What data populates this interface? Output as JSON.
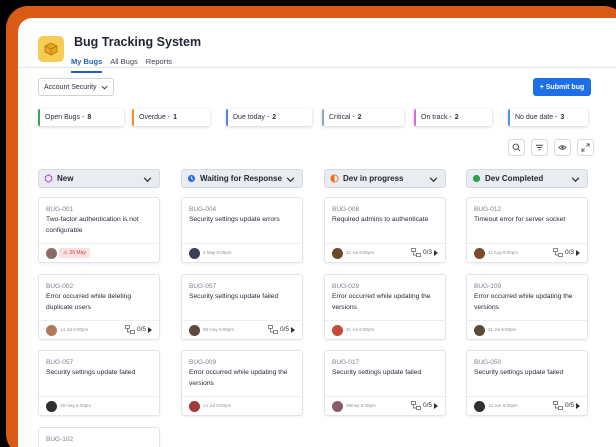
{
  "app": {
    "title": "Bug Tracking System"
  },
  "tabs": [
    {
      "label": "My Bugs",
      "active": true
    },
    {
      "label": "All Bugs",
      "active": false
    },
    {
      "label": "Reports",
      "active": false
    }
  ],
  "toolbar": {
    "account_selector": "Account Security",
    "submit_label": "+ Submit bug"
  },
  "filters": [
    {
      "label": "Open Bugs - ",
      "count": "8",
      "color": "#3aa757"
    },
    {
      "label": "Overdue - ",
      "count": "1",
      "color": "#f08c2e"
    },
    {
      "label": "Due today - ",
      "count": "2",
      "color": "#5a7fe0"
    },
    {
      "label": "Critical - ",
      "count": "2",
      "color": "#8ea4c2"
    },
    {
      "label": "On track - ",
      "count": "2",
      "color": "#d76ed0"
    },
    {
      "label": "No due date - ",
      "count": "3",
      "color": "#4a9be6"
    }
  ],
  "view_tools": [
    "search-icon",
    "filter-icon",
    "eye-icon",
    "expand-icon"
  ],
  "columns": [
    {
      "title": "New",
      "icon": "hexagon-icon",
      "color": "#b94fd6",
      "cards": [
        {
          "id": "BUG-001",
          "title": "Two-factor authentication is not configurable",
          "badge": "25 May",
          "date": "",
          "subtasks": "",
          "avatar": "#8a6e64"
        },
        {
          "id": "BUG-002",
          "title": "Error occurred while deleting duplicate users",
          "badge": "",
          "date": "14 Jul 6:00pm",
          "subtasks": "0/5",
          "avatar": ""
        },
        {
          "id": "BUG-057",
          "title": "Security settings update failed",
          "badge": "",
          "date": "29 may 6:00pm",
          "subtasks": "",
          "avatar": "#2f2f2f"
        },
        {
          "id": "BUG-102",
          "title": "",
          "badge": "",
          "date": "",
          "subtasks": "",
          "avatar": ""
        }
      ]
    },
    {
      "title": "Waiting for Response",
      "icon": "clock-icon",
      "color": "#2f6fe0",
      "cards": [
        {
          "id": "BUG-004",
          "title": "Security settings update errors",
          "badge": "",
          "date": "5 May 6:00pm",
          "subtasks": "",
          "avatar": "#3b3f58"
        },
        {
          "id": "BUG-057",
          "title": "Security settings update failed",
          "badge": "",
          "date": "08 may 6:00pm",
          "subtasks": "0/5",
          "avatar": "#5a4a3e"
        },
        {
          "id": "BUG-009",
          "title": "Error occurred while updating the versions",
          "badge": "",
          "date": "14 Jul 6:00pm",
          "subtasks": "",
          "avatar": "#a03a3a"
        }
      ]
    },
    {
      "title": "Dev in progress",
      "icon": "half-circle-icon",
      "color": "#ea6d1f",
      "cards": [
        {
          "id": "BUG-008",
          "title": "Required admins to authenticate",
          "badge": "",
          "date": "31 Jul 6:00pm",
          "subtasks": "0/3",
          "avatar": "#6b4a2a"
        },
        {
          "id": "BUG-029",
          "title": "Error occurred while updating the versions",
          "badge": "",
          "date": "31 Jul 6:00pm",
          "subtasks": "",
          "avatar": "#c44a3a"
        },
        {
          "id": "BUG-017",
          "title": "Security settings update failed",
          "badge": "",
          "date": "29may 6:00pm",
          "subtasks": "0/5",
          "avatar": "#8a5a6a"
        }
      ]
    },
    {
      "title": "Dev Completed",
      "icon": "check-circle-icon",
      "color": "#2aa34a",
      "cards": [
        {
          "id": "BUG-012",
          "title": "Timeout error for server socket",
          "badge": "",
          "date": "11 Aug 6:00pm",
          "subtasks": "0/3",
          "avatar": "#7a4a2a"
        },
        {
          "id": "BUG-109",
          "title": "Error occurred while updating the versions",
          "badge": "",
          "date": "31 Jul 6:00pm",
          "subtasks": "",
          "avatar": "#5a4a3a"
        },
        {
          "id": "BUG-050",
          "title": "Security settings update failed",
          "badge": "",
          "date": "12 Jun 6:00pm",
          "subtasks": "0/5",
          "avatar": "#2f2f2f"
        }
      ]
    }
  ]
}
